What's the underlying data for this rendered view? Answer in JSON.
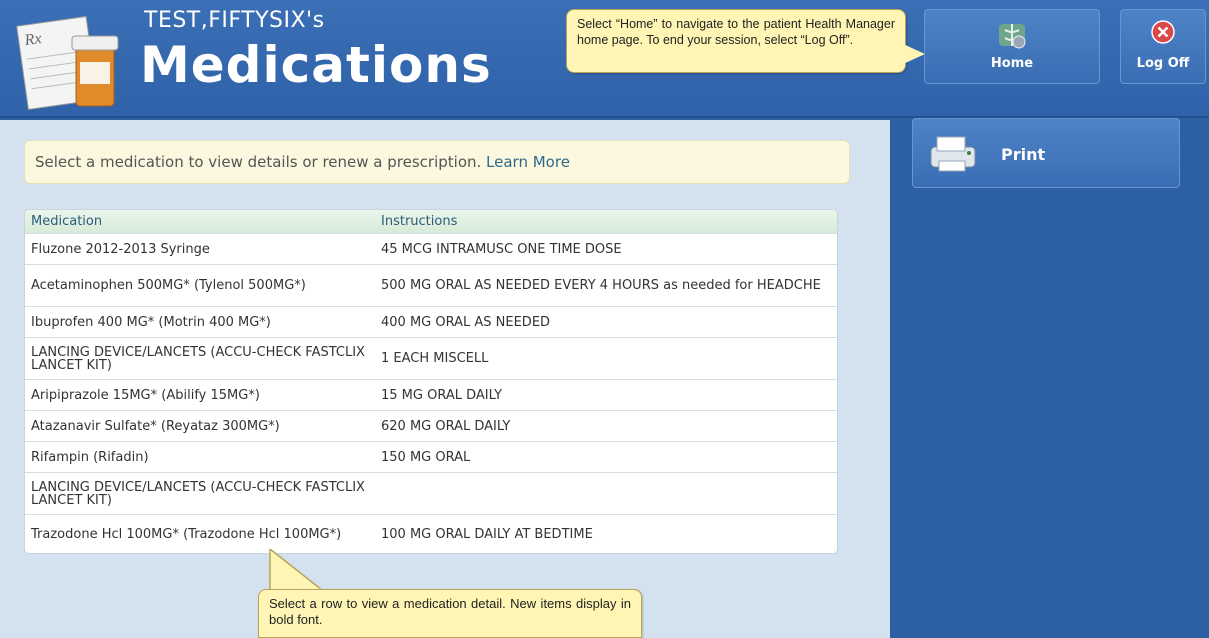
{
  "header": {
    "patient_name": "TEST,FIFTYSIX's",
    "title": "Medications",
    "logo_icon": "rx-prescription-icon",
    "home_label": "Home",
    "logoff_label": "Log Off",
    "home_callout": "Select “Home” to navigate to the patient Health Manager home page. To end your session, select “Log Off”."
  },
  "info_bar": {
    "text": "Select a medication to view details or renew a prescription.",
    "link": "Learn More"
  },
  "table": {
    "headers": [
      "Medication",
      "Instructions"
    ],
    "rows": [
      {
        "medication": "Fluzone 2012-2013 Syringe",
        "instructions": "45 MCG INTRAMUSC ONE TIME DOSE"
      },
      {
        "medication": "Acetaminophen 500MG* (Tylenol 500MG*)",
        "instructions": "500 MG ORAL AS NEEDED EVERY 4 HOURS as needed for HEADCHE"
      },
      {
        "medication": "Ibuprofen 400 MG* (Motrin 400 MG*)",
        "instructions": "400 MG ORAL AS NEEDED"
      },
      {
        "medication": "LANCING DEVICE/LANCETS (ACCU-CHECK FASTCLIX LANCET KIT)",
        "instructions": "1 EACH MISCELL"
      },
      {
        "medication": "Aripiprazole 15MG* (Abilify 15MG*)",
        "instructions": "15 MG ORAL DAILY"
      },
      {
        "medication": "Atazanavir Sulfate* (Reyataz 300MG*)",
        "instructions": "620 MG ORAL DAILY"
      },
      {
        "medication": "Rifampin (Rifadin)",
        "instructions": "150 MG ORAL"
      },
      {
        "medication": "LANCING DEVICE/LANCETS (ACCU-CHECK FASTCLIX LANCET KIT)",
        "instructions": ""
      },
      {
        "medication": "Trazodone Hcl 100MG* (Trazodone Hcl 100MG*)",
        "instructions": "100 MG ORAL DAILY AT BEDTIME"
      }
    ],
    "row_callout": "Select a row to view a medication detail. New items display in bold font."
  },
  "sidebar": {
    "print_label": "Print",
    "print_icon": "printer-icon"
  },
  "colors": {
    "header_blue": "#2f62a8",
    "main_bg": "#d3e2ee",
    "callout_yellow": "#fff6b5",
    "link": "#2e6a8a"
  }
}
